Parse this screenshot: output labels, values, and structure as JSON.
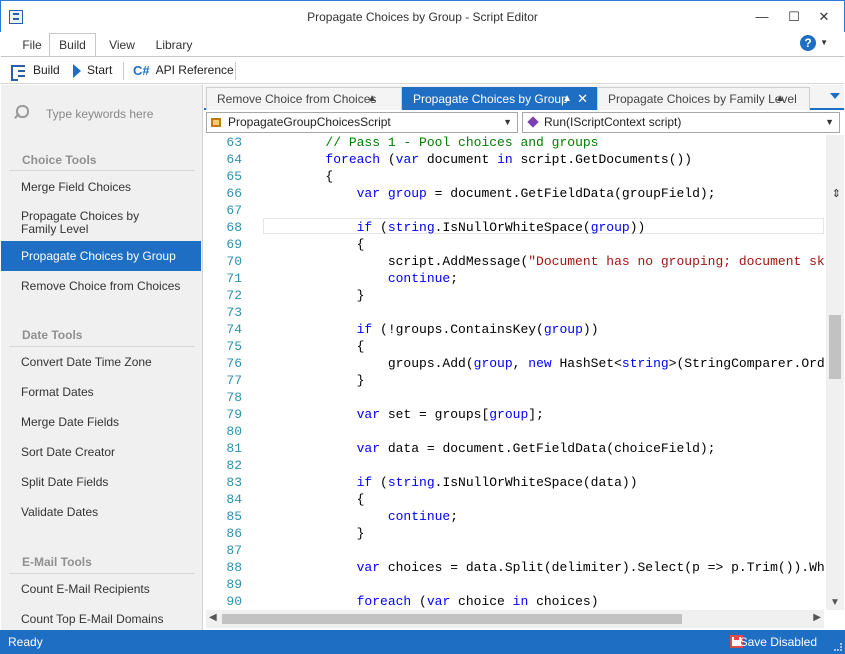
{
  "window": {
    "title": "Propagate Choices by Group - Script Editor"
  },
  "ribbon": {
    "tabs": [
      "File",
      "Build",
      "View",
      "Library"
    ],
    "active_tab": "Build"
  },
  "toolbar": {
    "build_label": "Build",
    "start_label": "Start",
    "api_label": "API Reference",
    "api_icon": "C#"
  },
  "sidebar": {
    "search_placeholder": "Type keywords here",
    "groups": [
      {
        "title": "Choice Tools",
        "items": [
          "Merge Field Choices",
          "Propagate Choices by Family Level",
          "Propagate Choices by Group",
          "Remove Choice from Choices"
        ]
      },
      {
        "title": "Date Tools",
        "items": [
          "Convert Date Time Zone",
          "Format Dates",
          "Merge Date Fields",
          "Sort Date Creator",
          "Split Date Fields",
          "Validate Dates"
        ]
      },
      {
        "title": "E-Mail Tools",
        "items": [
          "Count E-Mail Recipients",
          "Count Top E-Mail Domains"
        ]
      }
    ],
    "selected": "Propagate Choices by Group"
  },
  "editor": {
    "tabs": [
      {
        "label": "Remove Choice from Choices",
        "active": false
      },
      {
        "label": "Propagate Choices by Group",
        "active": true
      },
      {
        "label": "Propagate Choices by Family Level",
        "active": false
      }
    ],
    "class_combo": "PropagateGroupChoicesScript",
    "method_combo": "Run(IScriptContext script)",
    "current_line": 65,
    "lines": [
      {
        "n": 63,
        "tokens": [
          [
            "pl",
            "        "
          ],
          [
            "cm",
            "// Pass 1 - Pool choices and groups"
          ]
        ]
      },
      {
        "n": 64,
        "tokens": [
          [
            "pl",
            "        "
          ],
          [
            "kw",
            "foreach"
          ],
          [
            "pl",
            " ("
          ],
          [
            "kw",
            "var"
          ],
          [
            "pl",
            " document "
          ],
          [
            "kw",
            "in"
          ],
          [
            "pl",
            " script.GetDocuments())"
          ]
        ]
      },
      {
        "n": 65,
        "tokens": [
          [
            "pl",
            "        {"
          ]
        ]
      },
      {
        "n": 66,
        "tokens": [
          [
            "pl",
            "            "
          ],
          [
            "kw",
            "var"
          ],
          [
            "pl",
            " "
          ],
          [
            "kw",
            "group"
          ],
          [
            "pl",
            " = document.GetFieldData(groupField);"
          ]
        ]
      },
      {
        "n": 67,
        "tokens": []
      },
      {
        "n": 68,
        "tokens": [
          [
            "pl",
            "            "
          ],
          [
            "kw",
            "if"
          ],
          [
            "pl",
            " ("
          ],
          [
            "kw",
            "string"
          ],
          [
            "pl",
            ".IsNullOrWhiteSpace("
          ],
          [
            "kw",
            "group"
          ],
          [
            "pl",
            "))"
          ]
        ]
      },
      {
        "n": 69,
        "tokens": [
          [
            "pl",
            "            {"
          ]
        ]
      },
      {
        "n": 70,
        "tokens": [
          [
            "pl",
            "                script.AddMessage("
          ],
          [
            "st",
            "\"Document has no grouping; document skipped.\""
          ],
          [
            "pl",
            ")"
          ]
        ]
      },
      {
        "n": 71,
        "tokens": [
          [
            "pl",
            "                "
          ],
          [
            "kw",
            "continue"
          ],
          [
            "pl",
            ";"
          ]
        ]
      },
      {
        "n": 72,
        "tokens": [
          [
            "pl",
            "            }"
          ]
        ]
      },
      {
        "n": 73,
        "tokens": []
      },
      {
        "n": 74,
        "tokens": [
          [
            "pl",
            "            "
          ],
          [
            "kw",
            "if"
          ],
          [
            "pl",
            " (!groups.ContainsKey("
          ],
          [
            "kw",
            "group"
          ],
          [
            "pl",
            "))"
          ]
        ]
      },
      {
        "n": 75,
        "tokens": [
          [
            "pl",
            "            {"
          ]
        ]
      },
      {
        "n": 76,
        "tokens": [
          [
            "pl",
            "                groups.Add("
          ],
          [
            "kw",
            "group"
          ],
          [
            "pl",
            ", "
          ],
          [
            "kw",
            "new"
          ],
          [
            "pl",
            " HashSet<"
          ],
          [
            "kw",
            "string"
          ],
          [
            "pl",
            ">(StringComparer.OrdinalIgno"
          ]
        ]
      },
      {
        "n": 77,
        "tokens": [
          [
            "pl",
            "            }"
          ]
        ]
      },
      {
        "n": 78,
        "tokens": []
      },
      {
        "n": 79,
        "tokens": [
          [
            "pl",
            "            "
          ],
          [
            "kw",
            "var"
          ],
          [
            "pl",
            " set = groups["
          ],
          [
            "kw",
            "group"
          ],
          [
            "pl",
            "];"
          ]
        ]
      },
      {
        "n": 80,
        "tokens": []
      },
      {
        "n": 81,
        "tokens": [
          [
            "pl",
            "            "
          ],
          [
            "kw",
            "var"
          ],
          [
            "pl",
            " data = document.GetFieldData(choiceField);"
          ]
        ]
      },
      {
        "n": 82,
        "tokens": []
      },
      {
        "n": 83,
        "tokens": [
          [
            "pl",
            "            "
          ],
          [
            "kw",
            "if"
          ],
          [
            "pl",
            " ("
          ],
          [
            "kw",
            "string"
          ],
          [
            "pl",
            ".IsNullOrWhiteSpace(data))"
          ]
        ]
      },
      {
        "n": 84,
        "tokens": [
          [
            "pl",
            "            {"
          ]
        ]
      },
      {
        "n": 85,
        "tokens": [
          [
            "pl",
            "                "
          ],
          [
            "kw",
            "continue"
          ],
          [
            "pl",
            ";"
          ]
        ]
      },
      {
        "n": 86,
        "tokens": [
          [
            "pl",
            "            }"
          ]
        ]
      },
      {
        "n": 87,
        "tokens": []
      },
      {
        "n": 88,
        "tokens": [
          [
            "pl",
            "            "
          ],
          [
            "kw",
            "var"
          ],
          [
            "pl",
            " choices = data.Split(delimiter).Select(p => p.Trim()).Where(c=>!"
          ]
        ]
      },
      {
        "n": 89,
        "tokens": []
      },
      {
        "n": 90,
        "tokens": [
          [
            "pl",
            "            "
          ],
          [
            "kw",
            "foreach"
          ],
          [
            "pl",
            " ("
          ],
          [
            "kw",
            "var"
          ],
          [
            "pl",
            " choice "
          ],
          [
            "kw",
            "in"
          ],
          [
            "pl",
            " choices)"
          ]
        ]
      }
    ]
  },
  "status": {
    "left": "Ready",
    "right": "Save Disabled"
  },
  "colors": {
    "accent": "#1e6fc4",
    "comment": "#008000",
    "keyword": "#0000ff",
    "string": "#a31515",
    "line_number": "#2b91af"
  }
}
